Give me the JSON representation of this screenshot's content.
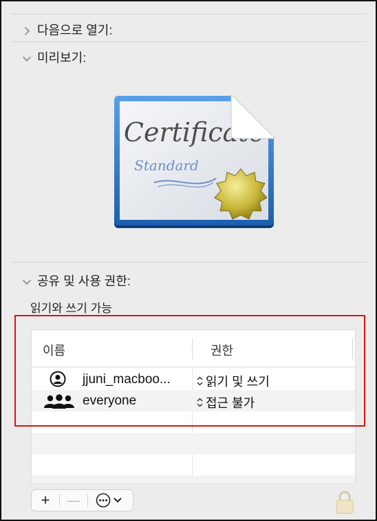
{
  "sections": {
    "open_with": "다음으로 열기:",
    "preview": "미리보기:",
    "sharing": "공유 및 사용 권한:"
  },
  "preview_image": {
    "certificate_title": "Certificate",
    "certificate_subtitle": "Standard"
  },
  "permission_summary": "읽기와 쓰기 가능",
  "table": {
    "headers": [
      "이름",
      "권한"
    ],
    "rows": [
      {
        "name": "jjuni_macboo...",
        "icon": "user-icon",
        "permission": "읽기 및 쓰기"
      },
      {
        "name": "everyone",
        "icon": "group-icon",
        "permission": "접근 불가"
      }
    ]
  },
  "toolbar": {
    "add": "+",
    "remove": "—",
    "more_icon": "ellipsis-circle-icon"
  },
  "lock_icon": "lock-icon",
  "highlight_color": "#e01010"
}
